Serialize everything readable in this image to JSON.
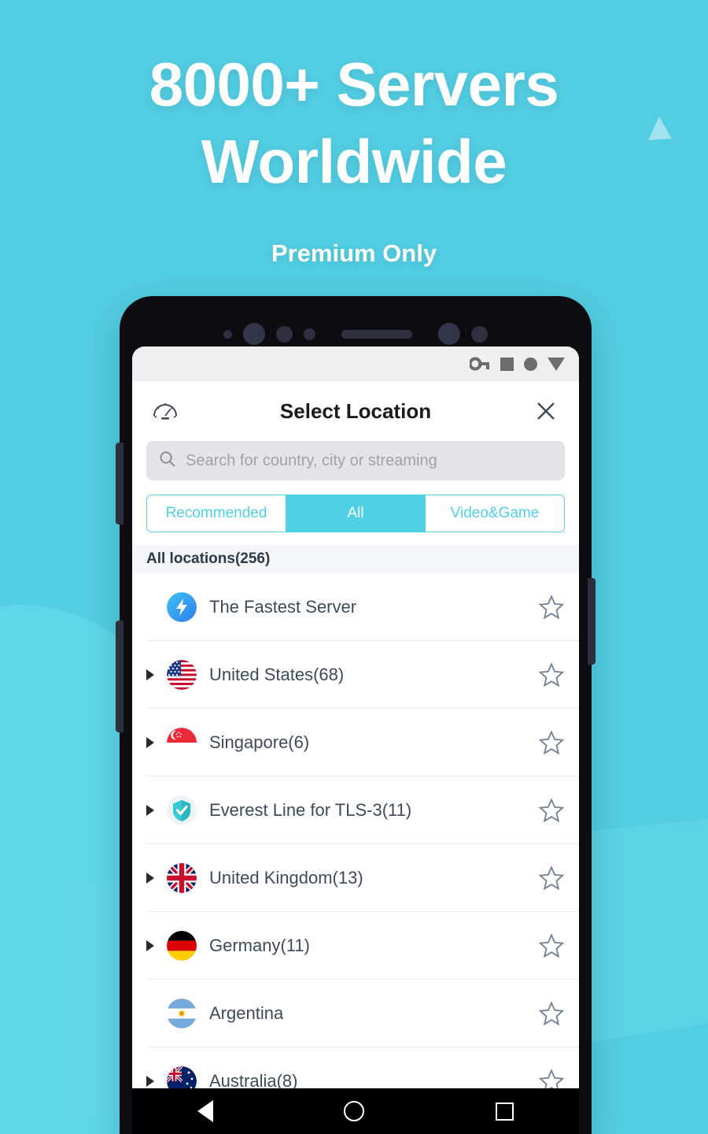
{
  "promo": {
    "title_line1": "8000+ Servers",
    "title_line2": "Worldwide",
    "subtitle": "Premium Only"
  },
  "colors": {
    "background": "#52cde2",
    "background_light": "#62d8e8",
    "accent": "#4fd0e4",
    "text_dark": "#3c4a5a",
    "status_icon": "#6d6d6d",
    "section_bg": "#f4f6f9",
    "search_bg": "#e4e4e6"
  },
  "statusbar": {
    "icons": [
      "vpn-key-icon",
      "square-icon",
      "circle-icon",
      "signal-triangle-icon"
    ]
  },
  "appbar": {
    "speed_icon": "speedometer-icon",
    "title": "Select Location",
    "close_icon": "close-icon"
  },
  "search": {
    "icon": "search-icon",
    "placeholder": "Search for country, city or streaming",
    "value": ""
  },
  "tabs": [
    {
      "label": "Recommended",
      "active": false
    },
    {
      "label": "All",
      "active": true
    },
    {
      "label": "Video&Game",
      "active": false
    }
  ],
  "section": {
    "header": "All locations(256)"
  },
  "locations": [
    {
      "label": "The Fastest Server",
      "icon": "fastest-bolt-icon",
      "expandable": false,
      "favorite": false
    },
    {
      "label": "United States(68)",
      "icon": "flag-us-icon",
      "expandable": true,
      "favorite": false
    },
    {
      "label": "Singapore(6)",
      "icon": "flag-sg-icon",
      "expandable": true,
      "favorite": false
    },
    {
      "label": "Everest Line for TLS-3(11)",
      "icon": "shield-check-icon",
      "expandable": true,
      "favorite": false
    },
    {
      "label": "United Kingdom(13)",
      "icon": "flag-uk-icon",
      "expandable": true,
      "favorite": false
    },
    {
      "label": "Germany(11)",
      "icon": "flag-de-icon",
      "expandable": true,
      "favorite": false
    },
    {
      "label": "Argentina",
      "icon": "flag-ar-icon",
      "expandable": false,
      "favorite": false
    },
    {
      "label": "Australia(8)",
      "icon": "flag-au-icon",
      "expandable": true,
      "favorite": false
    }
  ],
  "navbar": {
    "back": "back-nav-icon",
    "home": "home-nav-icon",
    "recents": "recents-nav-icon"
  }
}
